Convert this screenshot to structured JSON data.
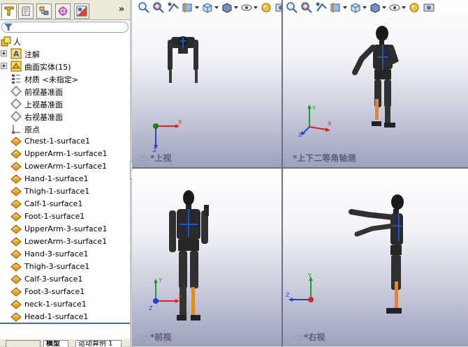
{
  "panel": {
    "tabs": [
      {
        "icon": "feature-manager-icon"
      },
      {
        "icon": "property-manager-icon"
      },
      {
        "icon": "configuration-manager-icon"
      },
      {
        "icon": "dimxpert-icon"
      },
      {
        "icon": "display-manager-icon"
      }
    ],
    "more_label": "»",
    "filter_icon": "filter-icon",
    "tree": {
      "root": "人",
      "items": [
        {
          "label": "注解",
          "icon": "annotation-icon",
          "expandable": true
        },
        {
          "label": "曲面实体(15)",
          "icon": "surface-bodies-icon",
          "expandable": true
        },
        {
          "label": "材质 <未指定>",
          "icon": "material-icon",
          "expandable": false
        },
        {
          "label": "前视基准面",
          "icon": "plane-icon",
          "expandable": false
        },
        {
          "label": "上视基准面",
          "icon": "plane-icon",
          "expandable": false
        },
        {
          "label": "右视基准面",
          "icon": "plane-icon",
          "expandable": false
        },
        {
          "label": "原点",
          "icon": "origin-icon",
          "expandable": false
        },
        {
          "label": "Chest-1-surface1",
          "icon": "surface-icon",
          "expandable": false
        },
        {
          "label": "UpperArm-1-surface1",
          "icon": "surface-icon",
          "expandable": false
        },
        {
          "label": "LowerArm-1-surface1",
          "icon": "surface-icon",
          "expandable": false
        },
        {
          "label": "Hand-1-surface1",
          "icon": "surface-icon",
          "expandable": false
        },
        {
          "label": "Thigh-1-surface1",
          "icon": "surface-icon",
          "expandable": false
        },
        {
          "label": "Calf-1-surface1",
          "icon": "surface-icon",
          "expandable": false
        },
        {
          "label": "Foot-1-surface1",
          "icon": "surface-icon",
          "expandable": false
        },
        {
          "label": "UpperArm-3-surface1",
          "icon": "surface-icon",
          "expandable": false
        },
        {
          "label": "LowerArm-3-surface1",
          "icon": "surface-icon",
          "expandable": false
        },
        {
          "label": "Hand-3-surface1",
          "icon": "surface-icon",
          "expandable": false
        },
        {
          "label": "Thigh-3-surface1",
          "icon": "surface-icon",
          "expandable": false
        },
        {
          "label": "Calf-3-surface1",
          "icon": "surface-icon",
          "expandable": false
        },
        {
          "label": "Foot-3-surface1",
          "icon": "surface-icon",
          "expandable": false
        },
        {
          "label": "neck-1-surface1",
          "icon": "surface-icon",
          "expandable": false
        },
        {
          "label": "Head-1-surface1",
          "icon": "surface-icon",
          "expandable": false
        }
      ]
    },
    "bottom_tabs": [
      "",
      "模型",
      "运动算例 1"
    ]
  },
  "viewports": {
    "top_left": {
      "label": "*上视",
      "axes": [
        "X",
        "Z"
      ]
    },
    "top_right": {
      "label": "*上下二等角轴测",
      "axes": [
        "X",
        "Y",
        "Z"
      ]
    },
    "bottom_left": {
      "label": "*前视",
      "axes": [
        "X",
        "Y",
        "Z"
      ]
    },
    "bottom_right": {
      "label": "*右视",
      "axes": [
        "Y",
        "Z"
      ]
    }
  },
  "toolbar_icons": [
    "zoom-fit-icon",
    "zoom-area-icon",
    "previous-view-icon",
    "section-view-icon",
    "view-orientation-icon",
    "display-style-icon",
    "hide-show-icon",
    "appearance-icon",
    "scene-icon"
  ],
  "colors": {
    "axis_x": "#e02020",
    "axis_y": "#18a018",
    "axis_z": "#2040e0",
    "selected_tree": "#ffffff",
    "divider": "#6e7088"
  }
}
